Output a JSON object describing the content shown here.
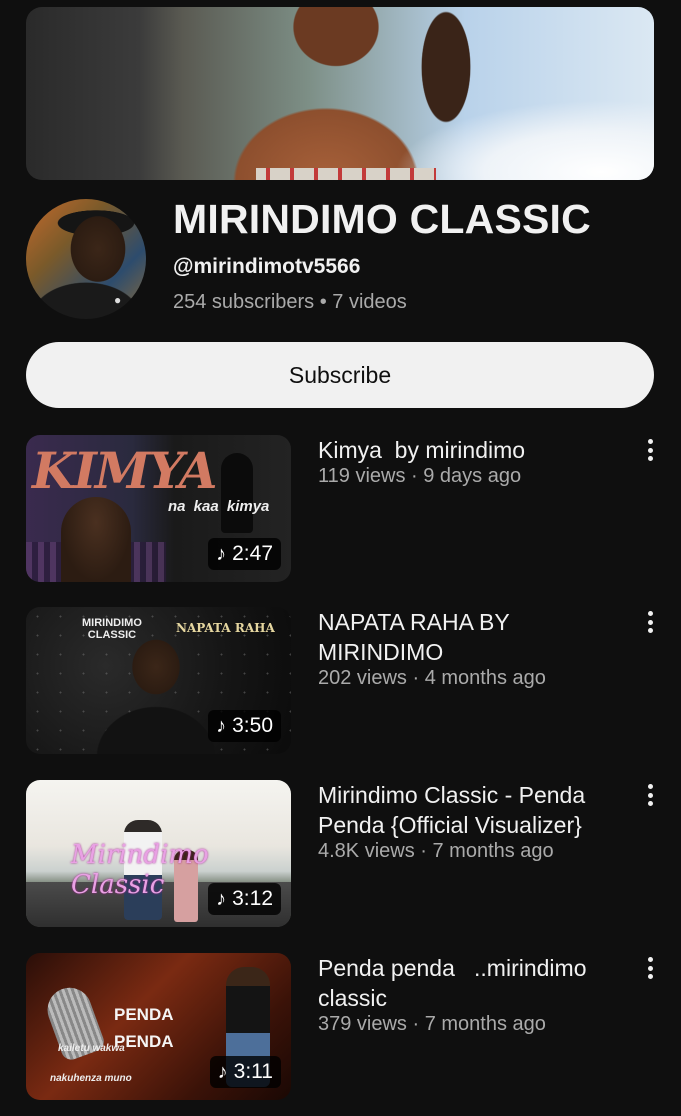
{
  "channel": {
    "name": "MIRINDIMO CLASSIC",
    "handle": "@mirindimotv5566",
    "meta": "254 subscribers • 7 videos",
    "subscribe_label": "Subscribe"
  },
  "videos": [
    {
      "title": "Kimya  by mirindimo",
      "meta": "119 views · 9 days ago",
      "duration": "2:47",
      "thumb_text": [
        "KIMYA",
        "na kaa kimya"
      ]
    },
    {
      "title": "NAPATA RAHA BY MIRINDIMO",
      "meta": "202 views · 4 months ago",
      "duration": "3:50",
      "thumb_text": [
        "MIRINDIMO\nCLASSIC",
        "NAPATA RAHA"
      ]
    },
    {
      "title": "Mirindimo Classic - Penda Penda {Official Visualizer}",
      "meta": "4.8K views · 7 months ago",
      "duration": "3:12",
      "thumb_text": [
        "Mirindimo Classic"
      ]
    },
    {
      "title": "Penda penda   ..mirindimo classic",
      "meta": "379 views · 7 months ago",
      "duration": "3:11",
      "thumb_text": [
        "PENDA\nPENDA",
        "kailetu wakwa",
        "nakuhenza muno"
      ]
    }
  ],
  "icons": {
    "music_note": "♪",
    "more": "vertical-ellipsis"
  },
  "colors": {
    "background": "#0f0f0f",
    "primary_text": "#f1f1f1",
    "secondary_text": "#aaaaaa",
    "subscribe_bg": "#f1f1f1"
  }
}
